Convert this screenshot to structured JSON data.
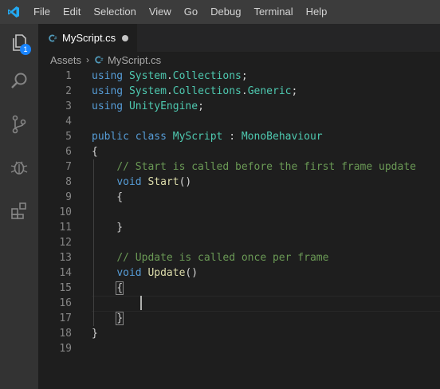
{
  "menu": [
    "File",
    "Edit",
    "Selection",
    "View",
    "Go",
    "Debug",
    "Terminal",
    "Help"
  ],
  "activity": {
    "explorer_badge": "1"
  },
  "tab": {
    "title": "MyScript.cs"
  },
  "breadcrumb": {
    "folder": "Assets",
    "separator": "›",
    "file": "MyScript.cs"
  },
  "editor": {
    "line_numbers": [
      "1",
      "2",
      "3",
      "4",
      "5",
      "6",
      "7",
      "8",
      "9",
      "10",
      "11",
      "12",
      "13",
      "14",
      "15",
      "16",
      "17",
      "18",
      "19"
    ],
    "lines": [
      [
        {
          "t": "kw",
          "v": "using "
        },
        {
          "t": "ty",
          "v": "System"
        },
        {
          "t": "pl",
          "v": "."
        },
        {
          "t": "ty",
          "v": "Collections"
        },
        {
          "t": "pl",
          "v": ";"
        }
      ],
      [
        {
          "t": "kw",
          "v": "using "
        },
        {
          "t": "ty",
          "v": "System"
        },
        {
          "t": "pl",
          "v": "."
        },
        {
          "t": "ty",
          "v": "Collections"
        },
        {
          "t": "pl",
          "v": "."
        },
        {
          "t": "ty",
          "v": "Generic"
        },
        {
          "t": "pl",
          "v": ";"
        }
      ],
      [
        {
          "t": "kw",
          "v": "using "
        },
        {
          "t": "ty",
          "v": "UnityEngine"
        },
        {
          "t": "pl",
          "v": ";"
        }
      ],
      [],
      [
        {
          "t": "kw",
          "v": "public class "
        },
        {
          "t": "ty",
          "v": "MyScript"
        },
        {
          "t": "pl",
          "v": " : "
        },
        {
          "t": "ty",
          "v": "MonoBehaviour"
        }
      ],
      [
        {
          "t": "pl",
          "v": "{"
        }
      ],
      [
        {
          "t": "pl",
          "v": "    "
        },
        {
          "t": "cm",
          "v": "// Start is called before the first frame update"
        }
      ],
      [
        {
          "t": "pl",
          "v": "    "
        },
        {
          "t": "kw",
          "v": "void "
        },
        {
          "t": "fn",
          "v": "Start"
        },
        {
          "t": "pl",
          "v": "()"
        }
      ],
      [
        {
          "t": "pl",
          "v": "    {"
        }
      ],
      [],
      [
        {
          "t": "pl",
          "v": "    }"
        }
      ],
      [],
      [
        {
          "t": "pl",
          "v": "    "
        },
        {
          "t": "cm",
          "v": "// Update is called once per frame"
        }
      ],
      [
        {
          "t": "pl",
          "v": "    "
        },
        {
          "t": "kw",
          "v": "void "
        },
        {
          "t": "fn",
          "v": "Update"
        },
        {
          "t": "pl",
          "v": "()"
        }
      ],
      [
        {
          "t": "pl",
          "v": "    "
        },
        {
          "t": "pl",
          "v": "{",
          "m": 1
        }
      ],
      [],
      [
        {
          "t": "pl",
          "v": "    "
        },
        {
          "t": "pl",
          "v": "}",
          "m": 1
        }
      ],
      [
        {
          "t": "pl",
          "v": "}"
        }
      ],
      []
    ]
  }
}
